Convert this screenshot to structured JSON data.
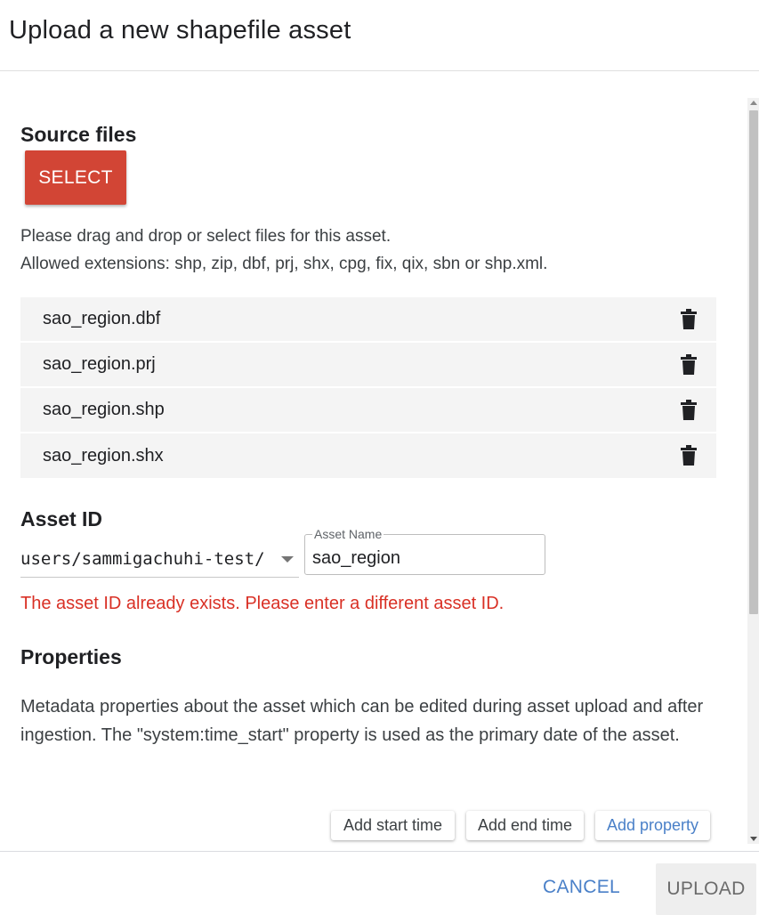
{
  "dialog": {
    "title": "Upload a new shapefile asset"
  },
  "source_files": {
    "heading": "Source files",
    "select_label": "SELECT",
    "hint_line1": "Please drag and drop or select files for this asset.",
    "hint_line2": "Allowed extensions: shp, zip, dbf, prj, shx, cpg, fix, qix, sbn or shp.xml.",
    "files": [
      {
        "name": "sao_region.dbf"
      },
      {
        "name": "sao_region.prj"
      },
      {
        "name": "sao_region.shp"
      },
      {
        "name": "sao_region.shx"
      }
    ]
  },
  "asset_id": {
    "heading": "Asset ID",
    "prefix": "users/sammigachuhi-test/",
    "name_label": "Asset Name",
    "name_value": "sao_region",
    "error": "The asset ID already exists. Please enter a different asset ID."
  },
  "properties": {
    "heading": "Properties",
    "description": "Metadata properties about the asset which can be edited during asset upload and after ingestion. The \"system:time_start\" property is used as the primary date of the asset.",
    "add_start_time": "Add start time",
    "add_end_time": "Add end time",
    "add_property": "Add property"
  },
  "footer": {
    "cancel_label": "CANCEL",
    "upload_label": "UPLOAD"
  },
  "colors": {
    "select_button": "#d24535",
    "error": "#d93025",
    "link_blue": "#4a80c8"
  },
  "icons": {
    "file_delete": "trash-icon"
  }
}
